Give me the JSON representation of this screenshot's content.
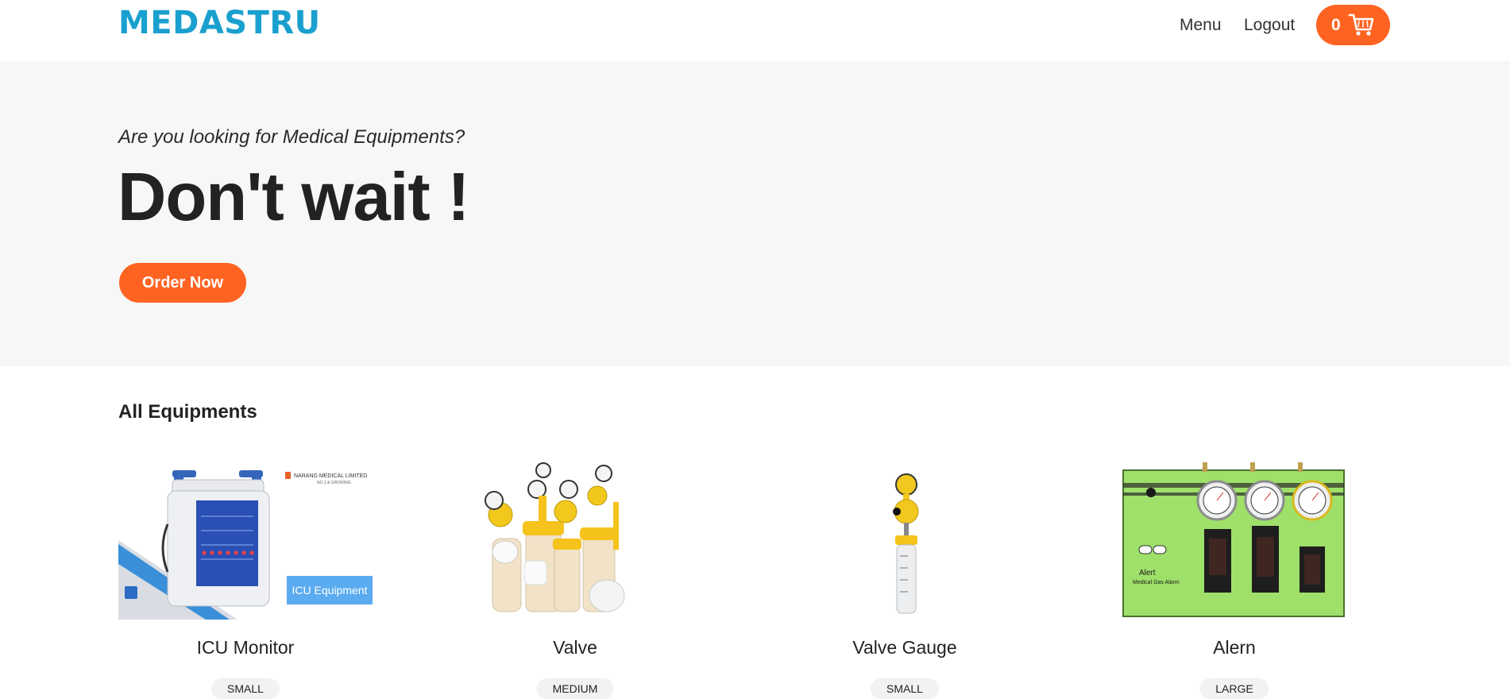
{
  "brand": {
    "logo": "MEDASTRU",
    "logo_color": "#1aa0cf",
    "accent": "#ff6321"
  },
  "nav": {
    "menu_label": "Menu",
    "logout_label": "Logout",
    "cart_count": "0",
    "cart_icon": "cart-icon"
  },
  "hero": {
    "subtitle": "Are you looking for Medical Equipments?",
    "title": "Don't wait !",
    "cta_label": "Order Now"
  },
  "section": {
    "title": "All Equipments"
  },
  "products": [
    {
      "name": "ICU Monitor",
      "size": "SMALL",
      "image": "icu-monitor-image",
      "image_caption": "ICU Equipment",
      "image_brand": "NARANG MEDICAL LIMITED",
      "image_brand_sub": "NO.1 & GROWING"
    },
    {
      "name": "Valve",
      "size": "MEDIUM",
      "image": "valves-image"
    },
    {
      "name": "Valve Gauge",
      "size": "SMALL",
      "image": "valve-gauge-image"
    },
    {
      "name": "Alern",
      "size": "LARGE",
      "image": "gas-alarm-panel-image",
      "image_caption": "Alert",
      "image_caption_sub": "Medical Gas Alarm"
    }
  ]
}
